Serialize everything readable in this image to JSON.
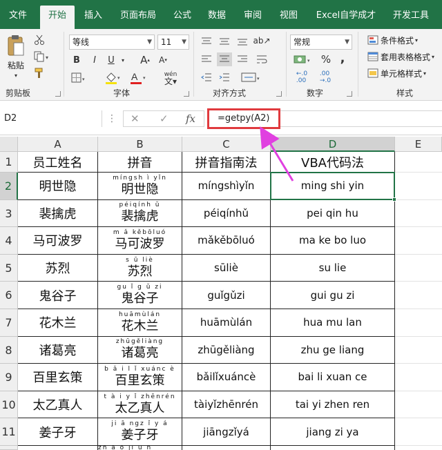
{
  "ribbon": {
    "tabs": [
      "文件",
      "开始",
      "插入",
      "页面布局",
      "公式",
      "数据",
      "审阅",
      "视图",
      "Excel自学成才",
      "开发工具"
    ],
    "active_tab": "开始",
    "clipboard": {
      "paste_label": "粘贴",
      "group_label": "剪贴板"
    },
    "font": {
      "font_name": "等线",
      "font_size": "11",
      "bold": "B",
      "italic": "I",
      "underline": "U",
      "grow": "A",
      "shrink": "A",
      "wen": "wén",
      "color_letter": "A",
      "group_label": "字体"
    },
    "alignment": {
      "group_label": "对齐方式"
    },
    "number": {
      "format": "常规",
      "percent": "%",
      "comma": ",",
      "group_label": "数字"
    },
    "styles": {
      "conditional": "条件格式",
      "table": "套用表格格式",
      "cell": "单元格样式",
      "group_label": "样式"
    },
    "accent_color": "#217346"
  },
  "formula_bar": {
    "name_box": "D2",
    "cancel": "✕",
    "enter": "✓",
    "fx": "fx",
    "formula": "=getpy(A2)",
    "highlight_color": "#e03a3e",
    "arrow_color": "#e040e0"
  },
  "sheet": {
    "columns": [
      "A",
      "B",
      "C",
      "D",
      "E"
    ],
    "selected_column": "D",
    "row_numbers": [
      "1",
      "2",
      "3",
      "4",
      "5",
      "6",
      "7",
      "8",
      "9",
      "10",
      "11"
    ],
    "selected_row": "2",
    "headers": [
      "员工姓名",
      "拼音",
      "拼音指南法",
      "VBA代码法"
    ],
    "rows": [
      {
        "name": "明世隐",
        "ruby": "míngsh ì yǐn",
        "pinyin": "míngshìyǐn",
        "vba": "ming shi yin"
      },
      {
        "name": "裴擒虎",
        "ruby": "péiqính ǔ",
        "pinyin": "péiqínhǔ",
        "vba": "pei qin hu"
      },
      {
        "name": "马可波罗",
        "ruby": "m ǎ kěbōluó",
        "pinyin": "mǎkěbōluó",
        "vba": "ma ke bo luo"
      },
      {
        "name": "苏烈",
        "ruby": "s ū liè",
        "pinyin": "sūliè",
        "vba": "su lie"
      },
      {
        "name": "鬼谷子",
        "ruby": "gu ǐ g ǔ zi",
        "pinyin": "guǐgǔzi",
        "vba": "gui gu zi"
      },
      {
        "name": "花木兰",
        "ruby": "huāmùlán",
        "pinyin": "huāmùlán",
        "vba": "hua mu lan"
      },
      {
        "name": "诸葛亮",
        "ruby": "zhūgěliàng",
        "pinyin": "zhūgěliàng",
        "vba": "zhu ge liang"
      },
      {
        "name": "百里玄策",
        "ruby": "b ǎ i l ǐ xuánc è",
        "pinyin": "bǎilǐxuáncè",
        "vba": "bai li xuan ce"
      },
      {
        "name": "太乙真人",
        "ruby": "t à i y ǐ zhēnrén",
        "pinyin": "tàiyǐzhēnrén",
        "vba": "tai yi zhen ren"
      },
      {
        "name": "姜子牙",
        "ruby": "ji ā ngz ǐ y á",
        "pinyin": "jiāngzǐyá",
        "vba": "jiang zi ya"
      }
    ],
    "partial_ruby": "zh ā o ji ū n",
    "active_cell": "D2"
  }
}
